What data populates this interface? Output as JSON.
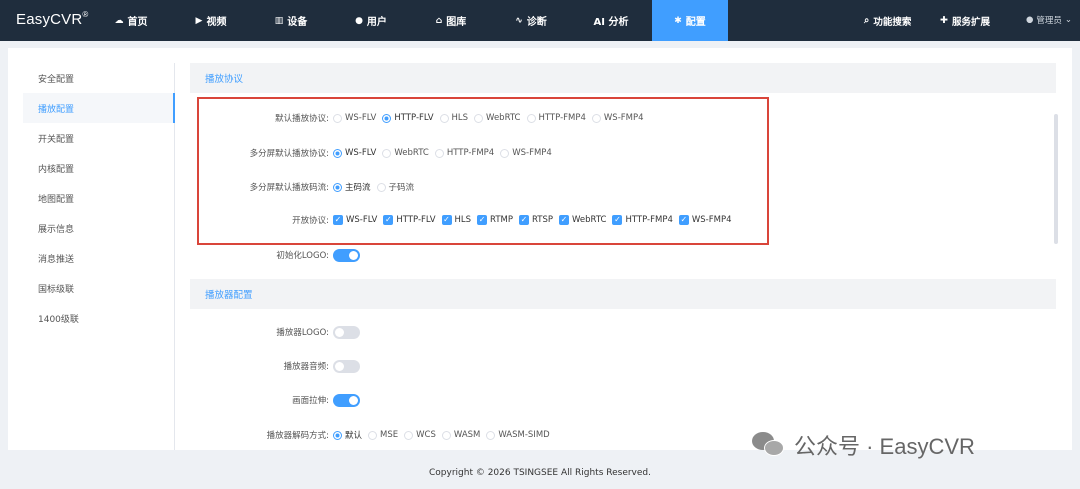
{
  "app": {
    "name": "EasyCVR",
    "mark": "®"
  },
  "nav": {
    "items": [
      {
        "icon": "dashboard-icon",
        "glyph": "☁",
        "label": "首页"
      },
      {
        "icon": "play-icon",
        "glyph": "▶",
        "label": "视频"
      },
      {
        "icon": "device-icon",
        "glyph": "▥",
        "label": "设备"
      },
      {
        "icon": "user-icon",
        "glyph": "●",
        "label": "用户"
      },
      {
        "icon": "library-icon",
        "glyph": "⌂",
        "label": "图库"
      },
      {
        "icon": "diagnose-icon",
        "glyph": "∿",
        "label": "诊断"
      },
      {
        "icon": "",
        "glyph": "",
        "label": "AI 分析"
      },
      {
        "icon": "gear-icon",
        "glyph": "✱",
        "label": "配置"
      }
    ],
    "active_index": 7,
    "right": [
      {
        "icon": "search-icon",
        "glyph": "⌕",
        "label": "功能搜索"
      },
      {
        "icon": "puzzle-icon",
        "glyph": "✚",
        "label": "服务扩展"
      }
    ],
    "user": {
      "icon": "user-icon",
      "glyph": "●",
      "label": "管理员",
      "caret": "⌄"
    }
  },
  "sidebar": {
    "items": [
      "安全配置",
      "播放配置",
      "开关配置",
      "内核配置",
      "地图配置",
      "展示信息",
      "消息推送",
      "国标级联",
      "1400级联"
    ],
    "active_index": 1
  },
  "sections": {
    "play_protocol": "播放协议",
    "player_config": "播放器配置"
  },
  "rows": {
    "default_protocol": {
      "label": "默认播放协议:",
      "options": [
        "WS-FLV",
        "HTTP-FLV",
        "HLS",
        "WebRTC",
        "HTTP-FMP4",
        "WS-FMP4"
      ],
      "selected": "HTTP-FLV"
    },
    "multi_screen_protocol": {
      "label": "多分屏默认播放协议:",
      "options": [
        "WS-FLV",
        "WebRTC",
        "HTTP-FMP4",
        "WS-FMP4"
      ],
      "selected": "WS-FLV"
    },
    "multi_screen_stream": {
      "label": "多分屏默认播放码流:",
      "options": [
        "主码流",
        "子码流"
      ],
      "selected": "主码流"
    },
    "open_protocols": {
      "label": "开放协议:",
      "options": [
        "WS-FLV",
        "HTTP-FLV",
        "HLS",
        "RTMP",
        "RTSP",
        "WebRTC",
        "HTTP-FMP4",
        "WS-FMP4"
      ],
      "checked_mark": "✓"
    },
    "init_logo": {
      "label": "初始化LOGO:",
      "on": true
    },
    "player_logo": {
      "label": "播放器LOGO:",
      "on": false
    },
    "player_audio": {
      "label": "播放器音频:",
      "on": false
    },
    "stretch": {
      "label": "画面拉伸:",
      "on": true
    },
    "decode_mode": {
      "label": "播放器解码方式:",
      "options": [
        "默认",
        "MSE",
        "WCS",
        "WASM",
        "WASM-SIMD"
      ],
      "selected": "默认"
    }
  },
  "colors": {
    "accent": "#409eff",
    "nav_bg": "#1f2d3d",
    "highlight": "#d9453a"
  },
  "footer": {
    "copyright": "Copyright © 2026 TSINGSEE All Rights Reserved."
  },
  "watermark": {
    "text": "公众号 · EasyCVR"
  }
}
